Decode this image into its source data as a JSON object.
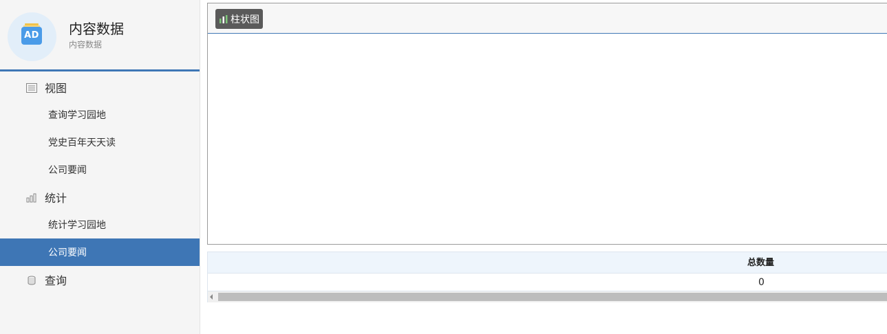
{
  "brand": {
    "badge": "AD",
    "title": "内容数据",
    "subtitle": "内容数据"
  },
  "menu": {
    "view_group": {
      "label": "视图",
      "icon": "list-icon"
    },
    "view_items": [
      "查询学习园地",
      "党史百年天天读",
      "公司要闻"
    ],
    "stats_group": {
      "label": "统计",
      "icon": "bar-chart-icon"
    },
    "stats_items": [
      "统计学习园地",
      "公司要闻"
    ],
    "query_group": {
      "label": "查询",
      "icon": "database-icon"
    },
    "active_item": "公司要闻"
  },
  "chart_toolbar": {
    "bar_chart_label": "柱状图",
    "icon": "bar-chart-icon"
  },
  "table": {
    "columns": [
      "总数量"
    ],
    "rows": [
      [
        "0"
      ]
    ]
  },
  "colors": {
    "accent": "#3e76b5",
    "sidebar_bg": "#f5f5f5",
    "table_header_bg": "#eef5fc",
    "button_bg": "#5a5a5a"
  }
}
